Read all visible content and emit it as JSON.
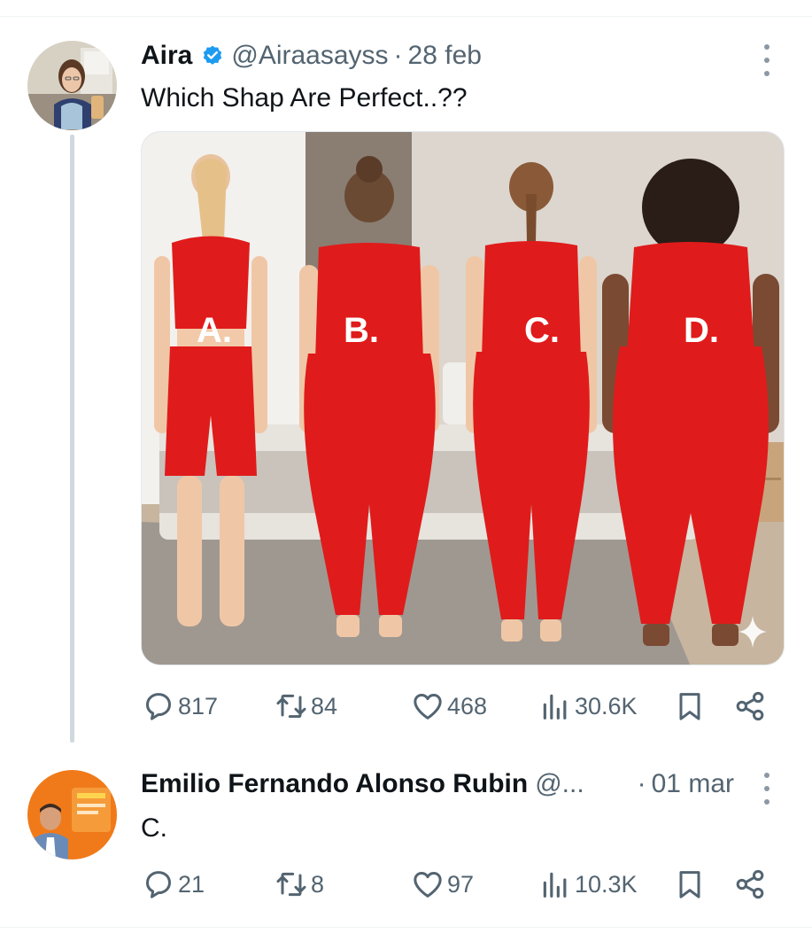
{
  "posts": [
    {
      "author_name": "Aira",
      "verified": true,
      "handle": "@Airaasayss",
      "separator": "·",
      "date": "28 feb",
      "text": "Which Shap Are Perfect..??",
      "media": {
        "labels": [
          "A.",
          "B.",
          "C.",
          "D."
        ]
      },
      "stats": {
        "replies": "817",
        "reposts": "84",
        "likes": "468",
        "views": "30.6K"
      }
    },
    {
      "author_name": "Emilio Fernando Alonso Rubin",
      "verified": false,
      "handle": "@...",
      "separator": "·",
      "date": "01 mar",
      "text": "C.",
      "stats": {
        "replies": "21",
        "reposts": "8",
        "likes": "97",
        "views": "10.3K"
      }
    }
  ],
  "icons": {
    "reply": "reply-icon",
    "repost": "repost-icon",
    "like": "heart-icon",
    "views": "views-icon",
    "bookmark": "bookmark-icon",
    "share": "share-icon",
    "more": "more-options-icon",
    "verified": "verified-badge-icon",
    "media_overlay": "sparkle-icon"
  },
  "colors": {
    "text_primary": "#0f1419",
    "text_secondary": "#536471",
    "verified_blue": "#1d9bf0",
    "outfit_red": "#e01b1b",
    "thread_line": "#cfd9de"
  }
}
